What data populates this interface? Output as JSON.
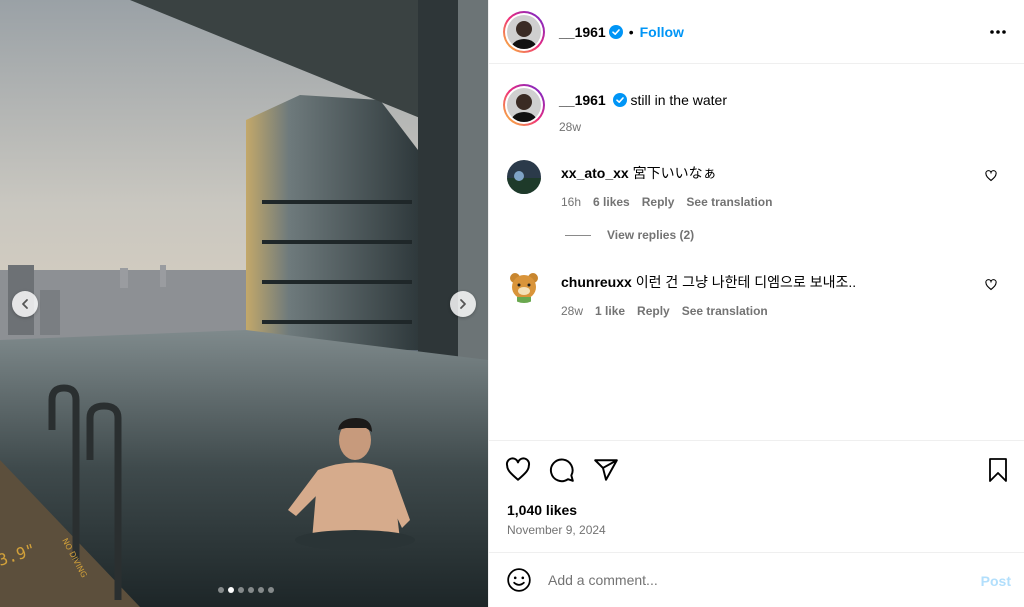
{
  "header": {
    "username": "__1961",
    "separator": "•",
    "follow_label": "Follow",
    "more_icon": "more-horizontal-icon"
  },
  "caption": {
    "username": "__1961",
    "text": "still in the water",
    "time": "28w"
  },
  "comments": [
    {
      "username": "xx_ato_xx",
      "text": "宮下いいなぁ",
      "time": "16h",
      "likes": "6 likes",
      "reply_label": "Reply",
      "translate_label": "See translation"
    },
    {
      "username": "chunreuxx",
      "text": "이런 건 그냥 나한테 디엠으로 보내조..",
      "time": "28w",
      "likes": "1 like",
      "reply_label": "Reply",
      "translate_label": "See translation"
    }
  ],
  "view_replies_label": "View replies (2)",
  "post": {
    "likes": "1,040 likes",
    "date": "November 9, 2024",
    "pool_marking": "3.9\"",
    "pool_marking_2": "NO DIVING"
  },
  "add_comment": {
    "placeholder": "Add a comment...",
    "post_label": "Post"
  },
  "carousel": {
    "total": 6,
    "active_index": 1
  },
  "colors": {
    "accent": "#0095f6",
    "verified": "#0095f6",
    "muted": "#737373",
    "post_disabled": "#b2dffc"
  }
}
